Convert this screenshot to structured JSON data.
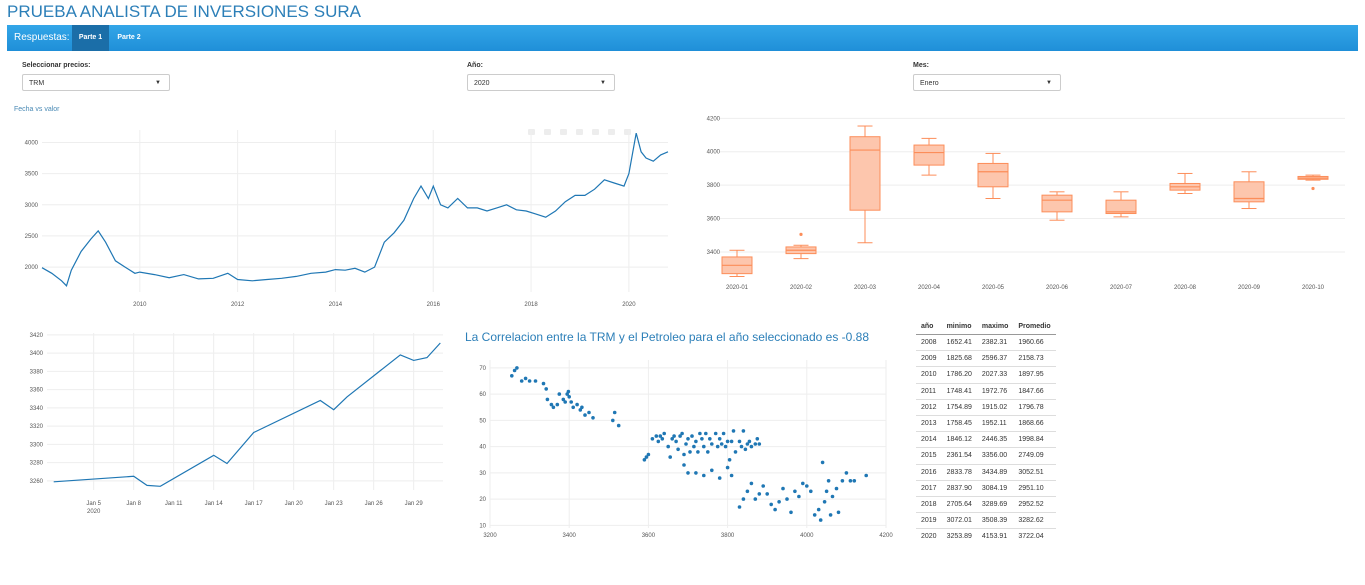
{
  "app_title": "PRUEBA ANALISTA DE INVERSIONES SURA",
  "navbar": {
    "brand": "Respuestas:",
    "tabs": [
      {
        "label": "Parte 1",
        "active": true
      },
      {
        "label": "Parte 2",
        "active": false
      }
    ]
  },
  "controls": {
    "precios": {
      "label": "Seleccionar precios:",
      "value": "TRM"
    },
    "anio": {
      "label": "Año:",
      "value": "2020"
    },
    "mes": {
      "label": "Mes:",
      "value": "Enero"
    }
  },
  "colors": {
    "blue": "#1f77b4",
    "orange": "#fc8d59",
    "orange_fill": "#fdc6ad"
  },
  "chart_data": [
    {
      "type": "line",
      "title": "Fecha vs valor",
      "x_ticks": [
        "2010",
        "2012",
        "2014",
        "2016",
        "2018",
        "2020"
      ],
      "y_ticks": [
        2000,
        2500,
        3000,
        3500,
        4000
      ],
      "ylim": [
        1600,
        4200
      ],
      "xlim": [
        2008.0,
        2020.8
      ],
      "series": [
        {
          "x": [
            2008.0,
            2008.2,
            2008.4,
            2008.5,
            2008.6,
            2008.8,
            2009.0,
            2009.15,
            2009.3,
            2009.5,
            2009.7,
            2009.9,
            2010.0,
            2010.3,
            2010.6,
            2010.9,
            2011.2,
            2011.5,
            2011.8,
            2012.0,
            2012.3,
            2012.6,
            2012.9,
            2013.2,
            2013.5,
            2013.8,
            2014.0,
            2014.2,
            2014.4,
            2014.6,
            2014.8,
            2015.0,
            2015.2,
            2015.4,
            2015.6,
            2015.75,
            2015.9,
            2016.0,
            2016.15,
            2016.3,
            2016.5,
            2016.7,
            2016.9,
            2017.1,
            2017.3,
            2017.5,
            2017.7,
            2017.9,
            2018.1,
            2018.3,
            2018.5,
            2018.7,
            2018.9,
            2019.1,
            2019.3,
            2019.5,
            2019.7,
            2019.9,
            2020.0,
            2020.15,
            2020.25,
            2020.35,
            2020.5,
            2020.65,
            2020.8
          ],
          "y": [
            1990,
            1900,
            1780,
            1700,
            1950,
            2250,
            2450,
            2580,
            2400,
            2100,
            2000,
            1900,
            1920,
            1880,
            1830,
            1880,
            1810,
            1820,
            1900,
            1800,
            1780,
            1800,
            1820,
            1850,
            1900,
            1920,
            1960,
            1950,
            1980,
            1920,
            2000,
            2400,
            2550,
            2750,
            3100,
            3300,
            3100,
            3300,
            3000,
            2950,
            3100,
            2950,
            2950,
            2900,
            2950,
            3000,
            2920,
            2900,
            2850,
            2800,
            2900,
            3050,
            3150,
            3150,
            3250,
            3400,
            3350,
            3300,
            3500,
            4150,
            3850,
            3750,
            3700,
            3800,
            3850
          ]
        }
      ]
    },
    {
      "type": "box",
      "categories": [
        "2020-01",
        "2020-02",
        "2020-03",
        "2020-04",
        "2020-05",
        "2020-06",
        "2020-07",
        "2020-08",
        "2020-09",
        "2020-10"
      ],
      "y_ticks": [
        3400,
        3600,
        3800,
        4000,
        4200
      ],
      "ylim": [
        3220,
        4220
      ],
      "boxes": [
        {
          "min": 3253,
          "q1": 3270,
          "median": 3320,
          "q3": 3370,
          "max": 3410,
          "outliers": []
        },
        {
          "min": 3360,
          "q1": 3390,
          "median": 3410,
          "q3": 3430,
          "max": 3440,
          "outliers": [
            3505
          ]
        },
        {
          "min": 3455,
          "q1": 3650,
          "median": 4010,
          "q3": 4090,
          "max": 4154,
          "outliers": []
        },
        {
          "min": 3860,
          "q1": 3920,
          "median": 3995,
          "q3": 4040,
          "max": 4080,
          "outliers": []
        },
        {
          "min": 3720,
          "q1": 3790,
          "median": 3880,
          "q3": 3930,
          "max": 3990,
          "outliers": []
        },
        {
          "min": 3590,
          "q1": 3640,
          "median": 3710,
          "q3": 3740,
          "max": 3760,
          "outliers": []
        },
        {
          "min": 3610,
          "q1": 3630,
          "median": 3640,
          "q3": 3710,
          "max": 3760,
          "outliers": []
        },
        {
          "min": 3750,
          "q1": 3770,
          "median": 3790,
          "q3": 3810,
          "max": 3870,
          "outliers": []
        },
        {
          "min": 3660,
          "q1": 3700,
          "median": 3720,
          "q3": 3820,
          "max": 3880,
          "outliers": []
        },
        {
          "min": 3830,
          "q1": 3835,
          "median": 3842,
          "q3": 3852,
          "max": 3860,
          "outliers": [
            3780
          ]
        }
      ]
    },
    {
      "type": "line",
      "x_ticks": [
        "Jan 5",
        "Jan 8",
        "Jan 11",
        "Jan 14",
        "Jan 17",
        "Jan 20",
        "Jan 23",
        "Jan 26",
        "Jan 29"
      ],
      "x_tick_sub": "2020",
      "y_ticks": [
        3260,
        3280,
        3300,
        3320,
        3340,
        3360,
        3380,
        3400,
        3420
      ],
      "ylim": [
        3250,
        3422
      ],
      "xlim": [
        1.5,
        31.2
      ],
      "series": [
        {
          "x": [
            2,
            8,
            9,
            10,
            14,
            15,
            17,
            22,
            23,
            24,
            28,
            29,
            30,
            31
          ],
          "y": [
            3259,
            3265,
            3255,
            3254,
            3288,
            3279,
            3313,
            3348,
            3338,
            3352,
            3398,
            3392,
            3395,
            3411
          ]
        }
      ]
    },
    {
      "type": "scatter",
      "title": "La Correlacion entre la TRM y el Petroleo para el año seleccionado es -0.88",
      "x_ticks": [
        3200,
        3400,
        3600,
        3800,
        4000,
        4200
      ],
      "y_ticks": [
        10,
        20,
        30,
        40,
        50,
        60,
        70
      ],
      "xlim": [
        3200,
        4200
      ],
      "ylim": [
        9,
        73
      ],
      "points": [
        [
          3255,
          67
        ],
        [
          3262,
          69
        ],
        [
          3268,
          70
        ],
        [
          3280,
          65
        ],
        [
          3290,
          66
        ],
        [
          3300,
          65
        ],
        [
          3315,
          65
        ],
        [
          3335,
          64
        ],
        [
          3342,
          62
        ],
        [
          3345,
          58
        ],
        [
          3355,
          56
        ],
        [
          3360,
          55
        ],
        [
          3370,
          56
        ],
        [
          3375,
          60
        ],
        [
          3385,
          58
        ],
        [
          3390,
          57
        ],
        [
          3395,
          60
        ],
        [
          3398,
          61
        ],
        [
          3400,
          59
        ],
        [
          3405,
          57
        ],
        [
          3410,
          55
        ],
        [
          3420,
          56
        ],
        [
          3428,
          54
        ],
        [
          3432,
          55
        ],
        [
          3440,
          52
        ],
        [
          3450,
          53
        ],
        [
          3460,
          51
        ],
        [
          3510,
          50
        ],
        [
          3515,
          53
        ],
        [
          3525,
          48
        ],
        [
          3590,
          35
        ],
        [
          3595,
          36
        ],
        [
          3600,
          37
        ],
        [
          3610,
          43
        ],
        [
          3620,
          44
        ],
        [
          3625,
          42
        ],
        [
          3630,
          44
        ],
        [
          3635,
          43
        ],
        [
          3640,
          45
        ],
        [
          3650,
          40
        ],
        [
          3655,
          36
        ],
        [
          3660,
          43
        ],
        [
          3665,
          44
        ],
        [
          3670,
          42
        ],
        [
          3675,
          39
        ],
        [
          3680,
          44
        ],
        [
          3685,
          45
        ],
        [
          3690,
          37
        ],
        [
          3695,
          41
        ],
        [
          3700,
          43
        ],
        [
          3705,
          38
        ],
        [
          3710,
          44
        ],
        [
          3715,
          40
        ],
        [
          3720,
          42
        ],
        [
          3725,
          38
        ],
        [
          3730,
          45
        ],
        [
          3735,
          43
        ],
        [
          3740,
          40
        ],
        [
          3745,
          45
        ],
        [
          3750,
          38
        ],
        [
          3755,
          43
        ],
        [
          3760,
          41
        ],
        [
          3770,
          45
        ],
        [
          3775,
          40
        ],
        [
          3780,
          43
        ],
        [
          3785,
          41
        ],
        [
          3790,
          45
        ],
        [
          3795,
          40
        ],
        [
          3800,
          42
        ],
        [
          3805,
          35
        ],
        [
          3810,
          42
        ],
        [
          3815,
          46
        ],
        [
          3820,
          38
        ],
        [
          3830,
          42
        ],
        [
          3835,
          40
        ],
        [
          3840,
          46
        ],
        [
          3845,
          39
        ],
        [
          3850,
          41
        ],
        [
          3855,
          42
        ],
        [
          3860,
          40
        ],
        [
          3870,
          41
        ],
        [
          3875,
          43
        ],
        [
          3880,
          41
        ],
        [
          3690,
          33
        ],
        [
          3700,
          30
        ],
        [
          3720,
          30
        ],
        [
          3740,
          29
        ],
        [
          3760,
          31
        ],
        [
          3780,
          28
        ],
        [
          3800,
          32
        ],
        [
          3810,
          29
        ],
        [
          3830,
          17
        ],
        [
          3840,
          20
        ],
        [
          3850,
          23
        ],
        [
          3860,
          26
        ],
        [
          3870,
          20
        ],
        [
          3880,
          22
        ],
        [
          3890,
          25
        ],
        [
          3900,
          22
        ],
        [
          3910,
          18
        ],
        [
          3920,
          16
        ],
        [
          3930,
          19
        ],
        [
          3940,
          24
        ],
        [
          3950,
          20
        ],
        [
          3960,
          15
        ],
        [
          3970,
          23
        ],
        [
          3980,
          21
        ],
        [
          3990,
          26
        ],
        [
          4000,
          25
        ],
        [
          4010,
          23
        ],
        [
          4020,
          14
        ],
        [
          4030,
          16
        ],
        [
          4035,
          12
        ],
        [
          4040,
          34
        ],
        [
          4045,
          19
        ],
        [
          4050,
          23
        ],
        [
          4055,
          27
        ],
        [
          4060,
          14
        ],
        [
          4065,
          21
        ],
        [
          4075,
          24
        ],
        [
          4080,
          15
        ],
        [
          4090,
          27
        ],
        [
          4100,
          30
        ],
        [
          4110,
          27
        ],
        [
          4120,
          27
        ],
        [
          4150,
          29
        ]
      ]
    },
    {
      "type": "table",
      "columns": [
        "año",
        "minimo",
        "maximo",
        "Promedio"
      ],
      "rows": [
        [
          "2008",
          "1652.41",
          "2382.31",
          "1960.66"
        ],
        [
          "2009",
          "1825.68",
          "2596.37",
          "2158.73"
        ],
        [
          "2010",
          "1786.20",
          "2027.33",
          "1897.95"
        ],
        [
          "2011",
          "1748.41",
          "1972.76",
          "1847.66"
        ],
        [
          "2012",
          "1754.89",
          "1915.02",
          "1796.78"
        ],
        [
          "2013",
          "1758.45",
          "1952.11",
          "1868.66"
        ],
        [
          "2014",
          "1846.12",
          "2446.35",
          "1998.84"
        ],
        [
          "2015",
          "2361.54",
          "3356.00",
          "2749.09"
        ],
        [
          "2016",
          "2833.78",
          "3434.89",
          "3052.51"
        ],
        [
          "2017",
          "2837.90",
          "3084.19",
          "2951.10"
        ],
        [
          "2018",
          "2705.64",
          "3289.69",
          "2952.52"
        ],
        [
          "2019",
          "3072.01",
          "3508.39",
          "3282.62"
        ],
        [
          "2020",
          "3253.89",
          "4153.91",
          "3722.04"
        ]
      ]
    }
  ]
}
